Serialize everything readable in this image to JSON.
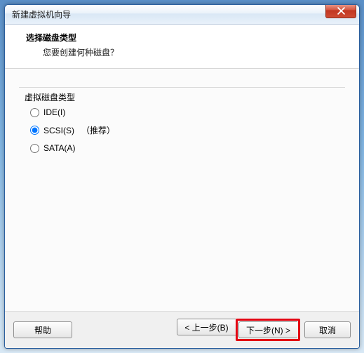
{
  "window": {
    "title": "新建虚拟机向导"
  },
  "header": {
    "title": "选择磁盘类型",
    "subtitle": "您要创建何种磁盘？"
  },
  "group": {
    "label": "虚拟磁盘类型",
    "options": {
      "ide": "IDE(I)",
      "scsi": "SCSI(S)",
      "scsi_recommend": "（推荐）",
      "sata": "SATA(A)"
    },
    "selected": "scsi"
  },
  "buttons": {
    "help": "帮助",
    "back": "< 上一步(B)",
    "next": "下一步(N) >",
    "cancel": "取消"
  }
}
